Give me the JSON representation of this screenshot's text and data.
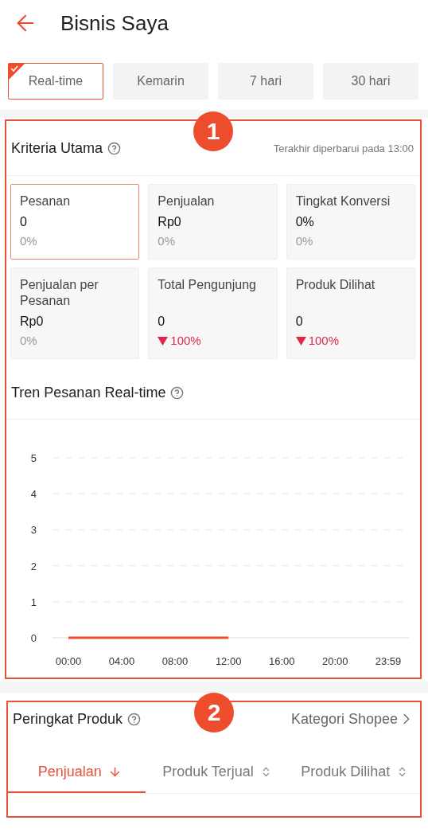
{
  "header": {
    "title": "Bisnis Saya"
  },
  "period_tabs": [
    {
      "label": "Real-time",
      "selected": true
    },
    {
      "label": "Kemarin",
      "selected": false
    },
    {
      "label": "7 hari",
      "selected": false
    },
    {
      "label": "30 hari",
      "selected": false
    }
  ],
  "key_metrics": {
    "annotation": "1",
    "title": "Kriteria Utama",
    "updated": "Terakhir diperbarui pada 13:00",
    "cards": [
      {
        "label": "Pesanan",
        "value": "0",
        "change": "0%",
        "down": false,
        "selected": true
      },
      {
        "label": "Penjualan",
        "value": "Rp0",
        "change": "0%",
        "down": false,
        "selected": false
      },
      {
        "label": "Tingkat Konversi",
        "value": "0%",
        "change": "0%",
        "down": false,
        "selected": false
      },
      {
        "label": "Penjualan per Pesanan",
        "value": "Rp0",
        "change": "0%",
        "down": false,
        "selected": false
      },
      {
        "label": "Total Pengunjung",
        "value": "0",
        "change": "100%",
        "down": true,
        "selected": false
      },
      {
        "label": "Produk Dilihat",
        "value": "0",
        "change": "100%",
        "down": true,
        "selected": false
      }
    ],
    "trend_title": "Tren Pesanan Real-time",
    "chart_data": {
      "type": "line",
      "x": [
        0,
        12
      ],
      "series": [
        {
          "color": "#ee4d2d",
          "values": [
            0,
            0
          ]
        }
      ],
      "xlim": [
        -1.19,
        25.53
      ],
      "ylim": [
        0,
        5
      ],
      "grid": true,
      "xticks": [
        {
          "value": 0,
          "label": "00:00"
        },
        {
          "value": 4,
          "label": "04:00"
        },
        {
          "value": 8,
          "label": "08:00"
        },
        {
          "value": 12,
          "label": "12:00"
        },
        {
          "value": 16,
          "label": "16:00"
        },
        {
          "value": 20,
          "label": "20:00"
        },
        {
          "value": 23.983,
          "label": "23:59"
        }
      ],
      "yticks": [
        0,
        1,
        2,
        3,
        4,
        5
      ]
    }
  },
  "product_ranking": {
    "annotation": "2",
    "title": "Peringkat Produk",
    "link": "Kategori Shopee",
    "tabs": [
      {
        "label": "Penjualan",
        "selected": true,
        "sorted": true
      },
      {
        "label": "Produk Terjual",
        "selected": false,
        "sorted": false
      },
      {
        "label": "Produk Dilihat",
        "selected": false,
        "sorted": false
      }
    ]
  }
}
